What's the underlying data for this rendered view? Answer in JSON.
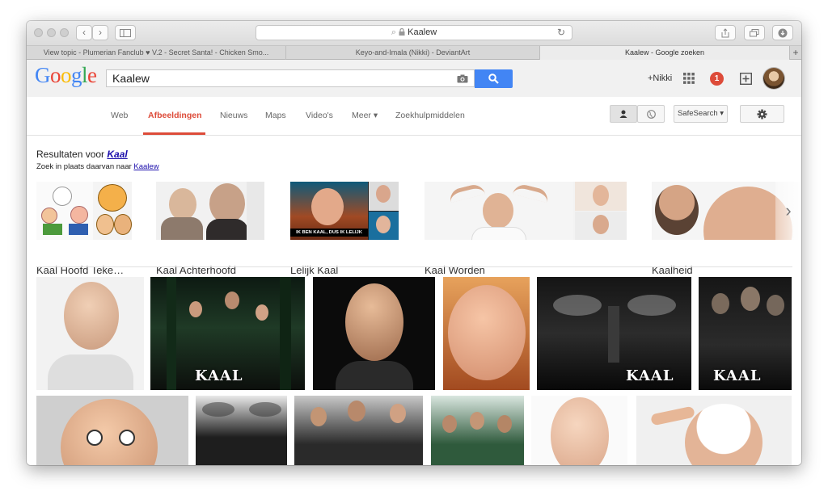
{
  "browser": {
    "address": "Kaalew",
    "tabs": [
      "View topic - Plumerian Fanclub ♥ V.2 - Secret Santa! - Chicken Smo...",
      "Keyo-and-Imala (Nikki) - DeviantArt",
      "Kaalew - Google zoeken"
    ],
    "new_tab": "+"
  },
  "header": {
    "logo_letters": [
      "G",
      "o",
      "o",
      "g",
      "l",
      "e"
    ],
    "logo_colors": [
      "#4285f4",
      "#ea4335",
      "#fbbc05",
      "#4285f4",
      "#34a853",
      "#ea4335"
    ],
    "query": "Kaalew",
    "user": "+Nikki",
    "notifications": "1"
  },
  "nav": {
    "items": [
      "Web",
      "Afbeeldingen",
      "Nieuws",
      "Maps",
      "Video's",
      "Meer ▾",
      "Zoekhulpmiddelen"
    ],
    "safesearch": "SafeSearch ▾"
  },
  "results": {
    "title_prefix": "Resultaten voor ",
    "title_term": "Kaal",
    "sub_prefix": "Zoek in plaats daarvan naar ",
    "sub_term": "Kaalew"
  },
  "related": [
    "Kaal Hoofd Teke…",
    "Kaal Achterhoofd",
    "Lelijk Kaal",
    "Kaal Worden",
    "Kaalheid"
  ],
  "lelijk_caption": "IK BEN KAAL, DUS IK LELIJK",
  "poster_title": "KAAL",
  "accent": "#dd4b39",
  "icons": [
    "back-icon",
    "forward-icon",
    "sidebar-icon",
    "lock-icon",
    "reload-icon",
    "share-icon",
    "tabs-icon",
    "download-icon",
    "camera-icon",
    "search-icon",
    "apps-grid-icon",
    "share-plus-icon",
    "person-icon",
    "globe-icon",
    "gear-icon",
    "chevron-right-icon"
  ]
}
